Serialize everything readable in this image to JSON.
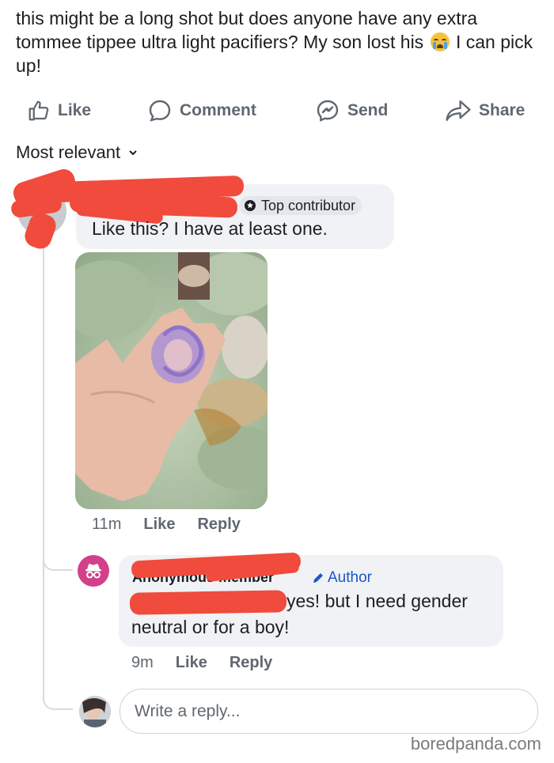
{
  "post": {
    "text_before_emoji": "this might be a long shot but does anyone have any extra tommee tippee ultra light pacifiers? My son lost his ",
    "text_after_emoji": " I can pick up!",
    "emoji": "crying-face-icon"
  },
  "actions": {
    "like": "Like",
    "comment": "Comment",
    "send": "Send",
    "share": "Share"
  },
  "sort": {
    "label": "Most relevant"
  },
  "comment1": {
    "badge": "Top contributor",
    "text": "Like this? I have at least one.",
    "time": "11m",
    "like": "Like",
    "reply": "Reply"
  },
  "comment2": {
    "name": "Anonymous member",
    "tag": "Author",
    "text": "yes! but I need gender neutral or for a boy!",
    "time": "9m",
    "like": "Like",
    "reply": "Reply"
  },
  "reply_box": {
    "placeholder": "Write a reply..."
  },
  "watermark": "boredpanda.com",
  "colors": {
    "redaction": "#f04b3c",
    "bubble": "#f0f2f5",
    "author_tag": "#1a56c8",
    "anon_avatar": "#d3408a"
  }
}
